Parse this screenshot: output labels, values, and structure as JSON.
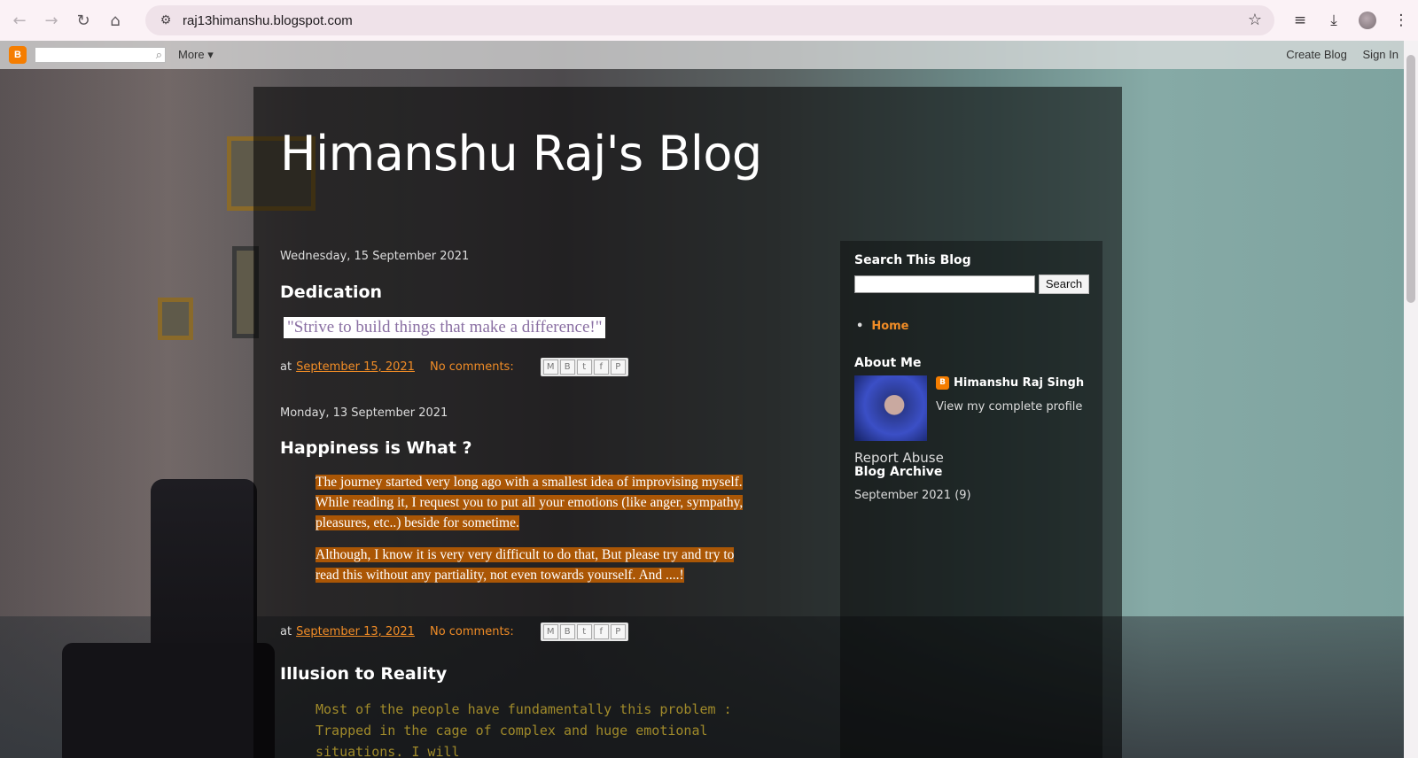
{
  "browser": {
    "url": "raj13himanshu.blogspot.com"
  },
  "blogger_nav": {
    "more": "More ▾",
    "create_blog": "Create Blog",
    "sign_in": "Sign In"
  },
  "blog": {
    "title": "Himanshu Raj's Blog"
  },
  "posts": [
    {
      "date": "Wednesday, 15 September 2021",
      "title": "Dedication",
      "quote": "\"Strive to build things that make a difference!\"",
      "at": "at",
      "time": "September 15, 2021",
      "comments": "No comments:"
    },
    {
      "date": "Monday, 13 September 2021",
      "title": "Happiness is What ?",
      "para1": "The journey started very long ago with a smallest idea of improvising myself. While reading it, I request you to put all your emotions (like anger, sympathy, pleasures, etc..) beside for sometime.",
      "para2": "Although, I know it is very very difficult to do that, But please try and try to read this without any partiality, not even towards yourself. And ....!",
      "at": "at",
      "time": "September 13, 2021",
      "comments": "No comments:"
    },
    {
      "title": "Illusion to Reality",
      "para1": "Most of the people have fundamentally this problem : Trapped in the cage of complex and huge emotional situations. I will"
    }
  ],
  "sidebar": {
    "search_title": "Search This Blog",
    "search_button": "Search",
    "home": "Home",
    "about_title": "About Me",
    "profile_name": "Himanshu Raj Singh",
    "profile_link": "View my complete profile",
    "report_abuse": "Report Abuse",
    "archive_title": "Blog Archive",
    "archive_item": "September 2021 (9)"
  },
  "colors": {
    "accent": "#f08c26",
    "highlight": "#c25f00"
  }
}
